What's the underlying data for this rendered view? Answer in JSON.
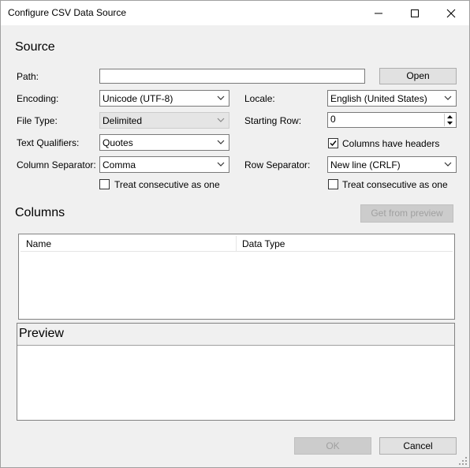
{
  "window": {
    "title": "Configure CSV Data Source"
  },
  "source": {
    "heading": "Source",
    "path_label": "Path:",
    "path_value": "",
    "open_button": "Open",
    "encoding_label": "Encoding:",
    "encoding_value": "Unicode (UTF-8)",
    "file_type_label": "File Type:",
    "file_type_value": "Delimited",
    "text_qualifiers_label": "Text Qualifiers:",
    "text_qualifiers_value": "Quotes",
    "column_separator_label": "Column Separator:",
    "column_separator_value": "Comma",
    "treat_consecutive_left_label": "Treat consecutive as one",
    "treat_consecutive_left_checked": false,
    "locale_label": "Locale:",
    "locale_value": "English (United States)",
    "starting_row_label": "Starting Row:",
    "starting_row_value": "0",
    "columns_have_headers_label": "Columns have headers",
    "columns_have_headers_checked": true,
    "row_separator_label": "Row Separator:",
    "row_separator_value": "New line (CRLF)",
    "treat_consecutive_right_label": "Treat consecutive as one",
    "treat_consecutive_right_checked": false
  },
  "columns": {
    "heading": "Columns",
    "get_from_preview_button": "Get from preview",
    "headers": [
      "Name",
      "Data Type"
    ]
  },
  "preview": {
    "heading": "Preview"
  },
  "footer": {
    "ok_button": "OK",
    "cancel_button": "Cancel"
  }
}
